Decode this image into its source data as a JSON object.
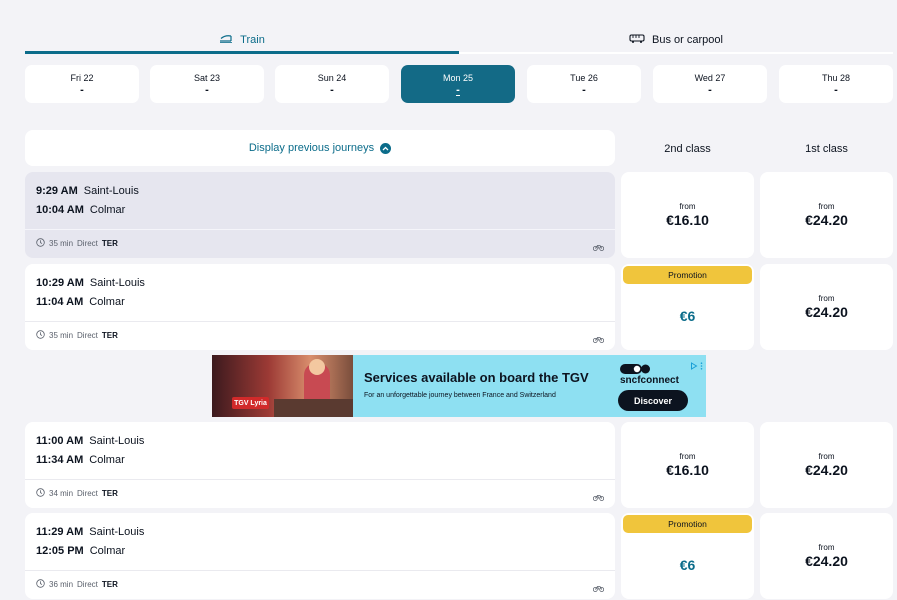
{
  "tabs": {
    "train_label": "Train",
    "bus_label": "Bus or carpool"
  },
  "dates": [
    {
      "day": "Fri 22",
      "value": "-"
    },
    {
      "day": "Sat 23",
      "value": "-"
    },
    {
      "day": "Sun 24",
      "value": "-"
    },
    {
      "day": "Mon 25",
      "value": "-"
    },
    {
      "day": "Tue 26",
      "value": "-"
    },
    {
      "day": "Wed 27",
      "value": "-"
    },
    {
      "day": "Thu 28",
      "value": "-"
    }
  ],
  "header": {
    "prev_label": "Display previous journeys",
    "col_second": "2nd class",
    "col_first": "1st class"
  },
  "journeys": [
    {
      "dep_time": "9:29 AM",
      "dep_station": "Saint-Louis",
      "arr_time": "10:04 AM",
      "arr_station": "Colmar",
      "duration": "35 min",
      "type": "Direct",
      "train": "TER",
      "second": {
        "from": "from",
        "price": "€16.10"
      },
      "first": {
        "from": "from",
        "price": "€24.20"
      }
    },
    {
      "dep_time": "10:29 AM",
      "dep_station": "Saint-Louis",
      "arr_time": "11:04 AM",
      "arr_station": "Colmar",
      "duration": "35 min",
      "type": "Direct",
      "train": "TER",
      "second": {
        "badge": "Promotion",
        "price": "€6"
      },
      "first": {
        "from": "from",
        "price": "€24.20"
      }
    },
    {
      "dep_time": "11:00 AM",
      "dep_station": "Saint-Louis",
      "arr_time": "11:34 AM",
      "arr_station": "Colmar",
      "duration": "34 min",
      "type": "Direct",
      "train": "TER",
      "second": {
        "from": "from",
        "price": "€16.10"
      },
      "first": {
        "from": "from",
        "price": "€24.20"
      }
    },
    {
      "dep_time": "11:29 AM",
      "dep_station": "Saint-Louis",
      "arr_time": "12:05 PM",
      "arr_station": "Colmar",
      "duration": "36 min",
      "type": "Direct",
      "train": "TER",
      "second": {
        "badge": "Promotion",
        "price": "€6"
      },
      "first": {
        "from": "from",
        "price": "€24.20"
      }
    }
  ],
  "ad": {
    "title": "Services available on board the TGV",
    "subtitle": "For an unforgettable journey between France and Switzerland",
    "logo": "TGV Lyria",
    "brand": "sncfconnect",
    "button": "Discover"
  },
  "colors": {
    "accent": "#0b6c8a",
    "active_date": "#136a86",
    "promo_badge": "#f0c53c",
    "selected_row": "#e6e6ef",
    "ad_bg": "#8ee0f2"
  }
}
